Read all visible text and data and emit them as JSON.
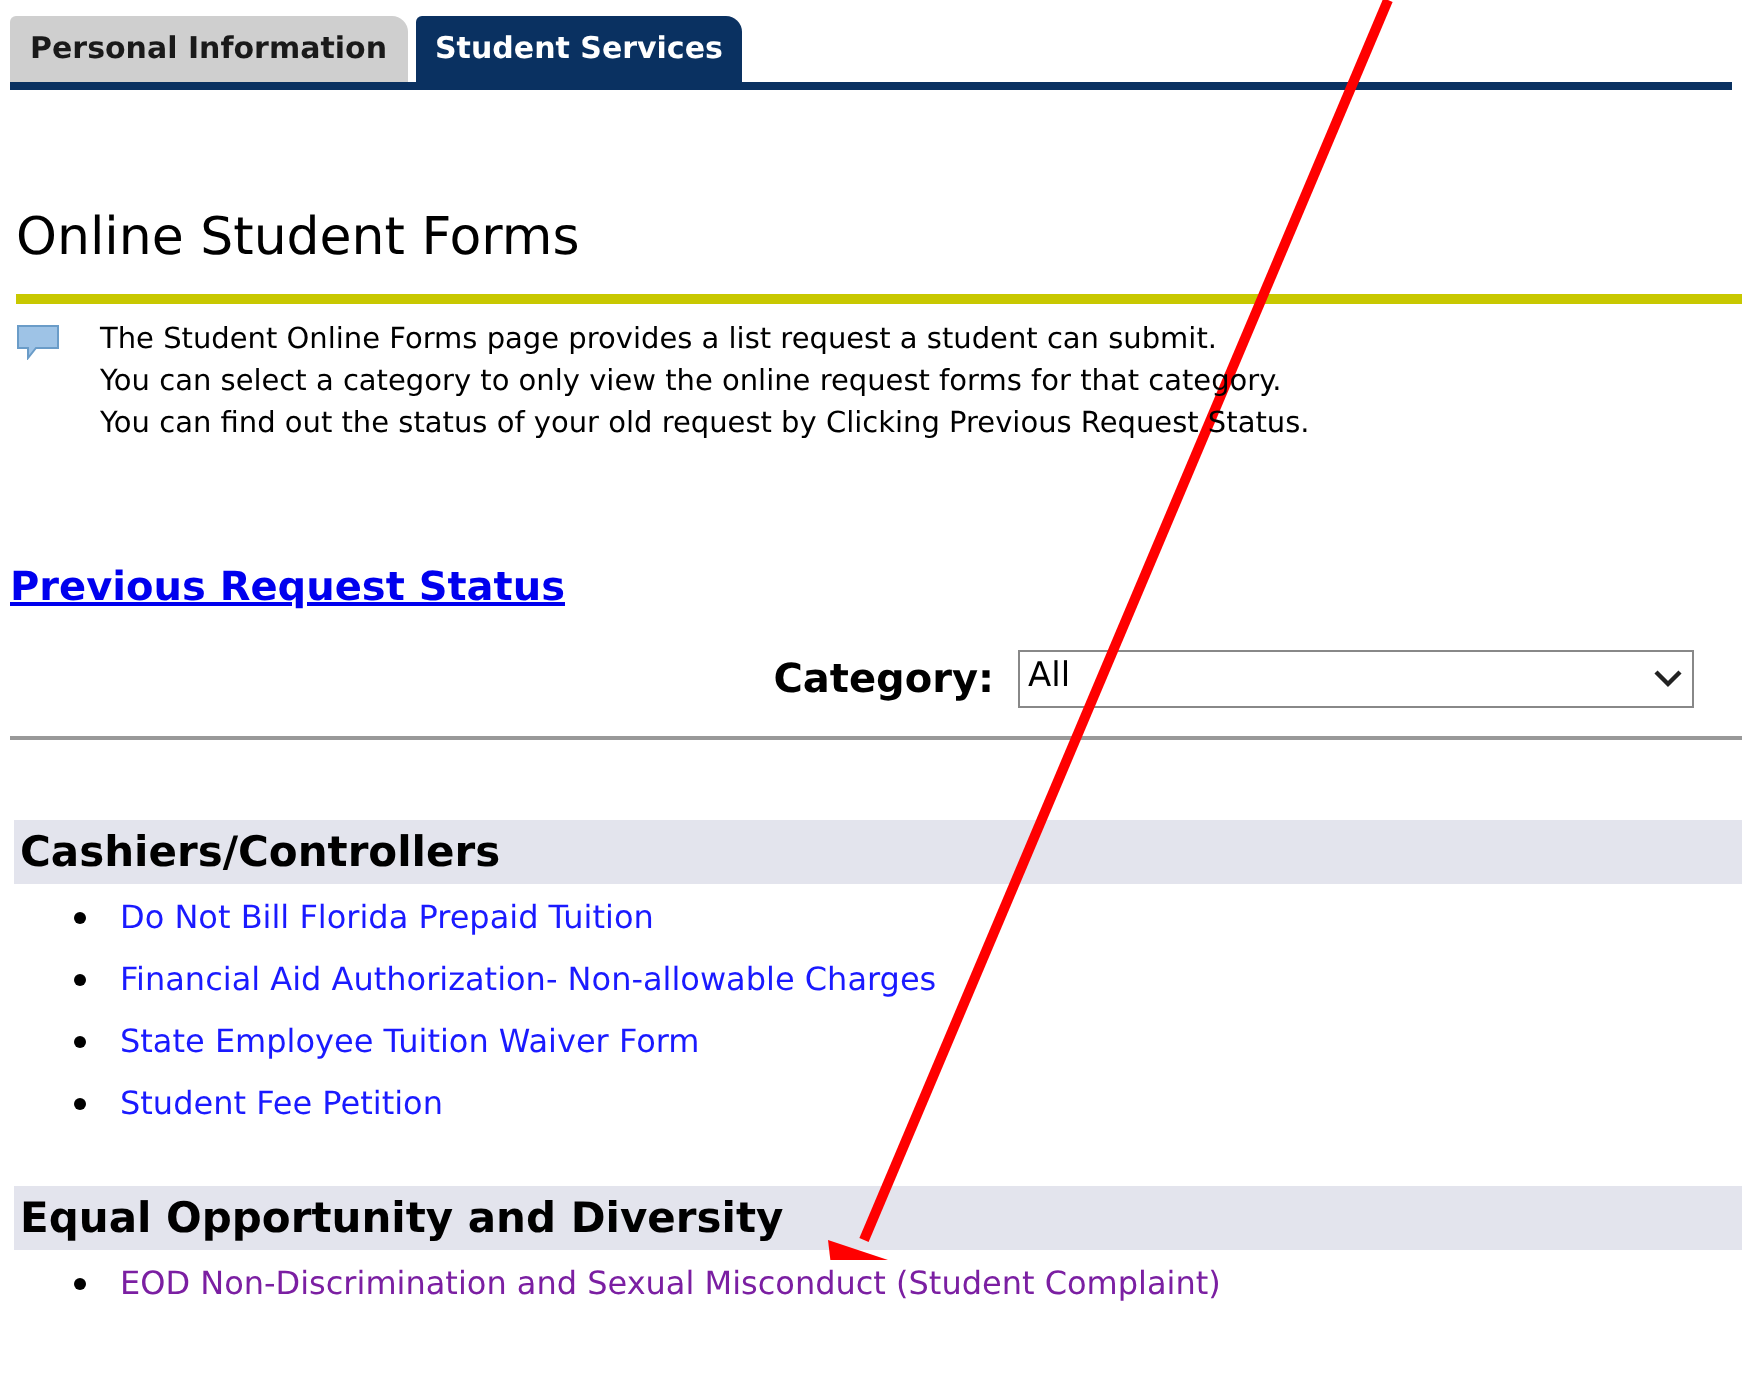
{
  "tabs": [
    {
      "label": "Personal Information",
      "selected": false
    },
    {
      "label": "Student Services",
      "selected": true
    }
  ],
  "title": "Online Student Forms",
  "info": [
    "The Student Online Forms page provides a list request a student can submit.",
    "You can select a category to only view the online request forms for that category.",
    "You can find out the status of your old request by Clicking Previous Request Status."
  ],
  "previous_link": "Previous Request Status",
  "category": {
    "label": "Category:",
    "value": "All"
  },
  "sections": [
    {
      "heading": "Cashiers/Controllers",
      "links": [
        {
          "label": "Do Not Bill Florida Prepaid Tuition",
          "visited": false
        },
        {
          "label": "Financial Aid Authorization- Non-allowable Charges",
          "visited": false
        },
        {
          "label": "State Employee Tuition Waiver Form",
          "visited": false
        },
        {
          "label": "Student Fee Petition",
          "visited": false
        }
      ]
    },
    {
      "heading": "Equal Opportunity and Diversity",
      "links": [
        {
          "label": "EOD Non-Discrimination and Sexual Misconduct (Student Complaint)",
          "visited": true
        }
      ]
    }
  ]
}
